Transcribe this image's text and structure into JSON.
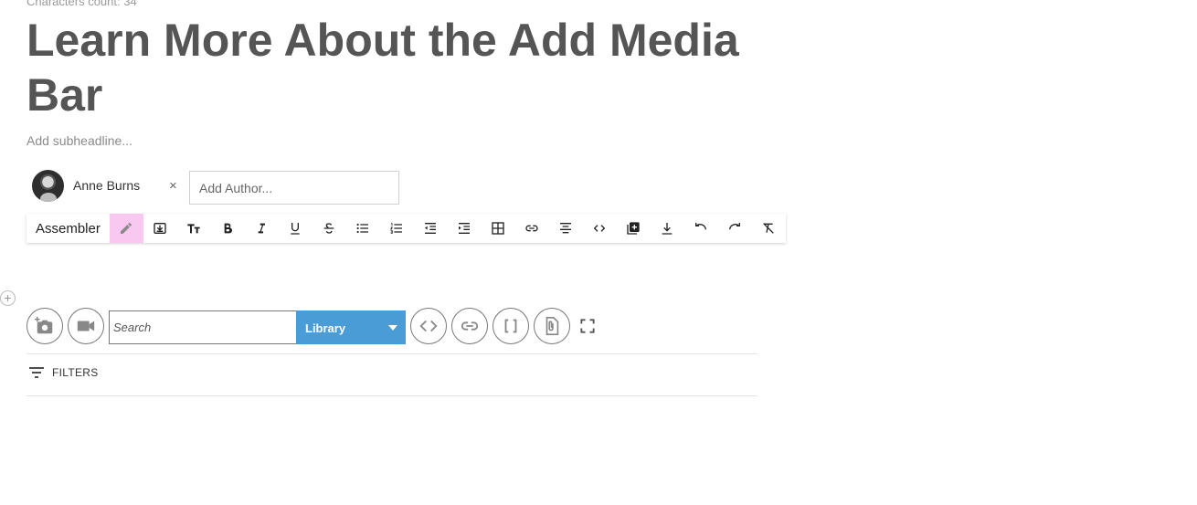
{
  "editor": {
    "char_count": "Characters count: 34",
    "headline": "Learn More About the Add Media Bar",
    "subheadline_placeholder": "Add subheadline..."
  },
  "author": {
    "name": "Anne Burns",
    "remove_label": "×",
    "input_placeholder": "Add Author..."
  },
  "toolbar": {
    "label": "Assembler",
    "active_color": "#f8c8f0",
    "buttons": [
      "edit-icon",
      "insert-icon",
      "text-size-icon",
      "bold-icon",
      "italic-icon",
      "underline-icon",
      "strikethrough-icon",
      "bulleted-list-icon",
      "numbered-list-icon",
      "outdent-icon",
      "indent-icon",
      "table-icon",
      "link-icon",
      "align-center-icon",
      "code-icon",
      "add-box-icon",
      "download-icon",
      "undo-icon",
      "redo-icon",
      "clear-format-icon"
    ]
  },
  "add_block": {
    "label": "+"
  },
  "media_bar": {
    "search_placeholder": "Search",
    "library_label": "Library",
    "library_color": "#4a9cd6",
    "icons": [
      "add-photo-icon",
      "video-icon",
      "embed-code-icon",
      "link-icon",
      "bracket-icon",
      "attachment-icon",
      "fullscreen-icon"
    ]
  },
  "filters": {
    "label": "FILTERS"
  }
}
